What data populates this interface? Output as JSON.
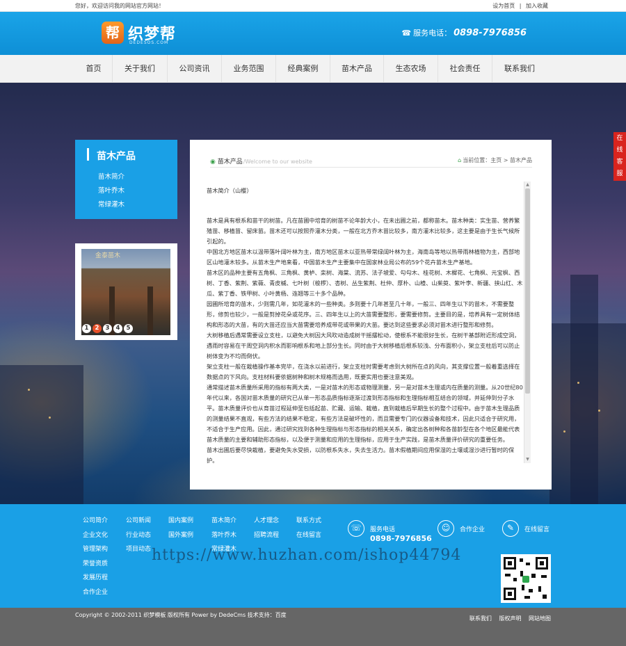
{
  "topbar": {
    "greeting": "您好，欢迎访问我的网站官方网站！",
    "set_home": "设为首页",
    "separator": "|",
    "add_fav": "加入收藏"
  },
  "header": {
    "logo_mark": "帮",
    "logo_text": "织梦帮",
    "logo_sub": "DEDESOS.COM",
    "hotline_label": "服务电话：",
    "hotline_number": "0898-7976856"
  },
  "nav": [
    "首页",
    "关于我们",
    "公司资讯",
    "业务范围",
    "经典案例",
    "苗木产品",
    "生态农场",
    "社会责任",
    "联系我们"
  ],
  "sidebar": {
    "title": "苗木产品",
    "items": [
      "苗木简介",
      "落叶乔木",
      "常绿灌木"
    ]
  },
  "slider": {
    "dots": [
      "1",
      "2",
      "3",
      "4",
      "5"
    ],
    "active_index": 2,
    "sign": "金泰苗木"
  },
  "content": {
    "title": "苗木产品",
    "title_en": "/Welcome to our website",
    "crumb_label": "当前位置：",
    "crumb_home": "主页",
    "crumb_sep": ">",
    "crumb_current": "苗木产品",
    "subtitle": "苗木简介（山樱）",
    "paragraphs": [
      "苗木是具有根系和苗干的树苗。凡在苗圃中培育的树苗不论年龄大小，在未出圃之前，都称苗木。苗木种类：实生苗、营养繁殖苗、移植苗、留床苗。苗木还可以按照乔灌木分类，一般在北方乔木苗比较多，南方灌木比较多，这主要是由于生长气候所引起的。",
      "中国北方地区苗木以温带落叶阔叶林为主，南方地区苗木以亚热带常绿阔叶林为主，海南岛等地以热带雨林植物为主，西部地区山地灌木较多。从苗木生产地来看，中国苗木生产主要集中在国家林业局公布的59个花卉苗木生产基地。",
      "苗木区的品种主要有五角枫、三角枫、黄栌、栾树、海棠、流苏、法子坡爱、勾勾木、桂花树、木樨花、七角枫、元宝枫、西树、丁香、紫荆、紫薇、青皮槭、七叶树（梭椤）、杏树、丛生紫荆、杜仲、厚朴、山楂、山茱萸、紫叶李、新疆、挟山红、木瓜、紫丁香、铁甲树、小叶黄杨、连翘等三十多个品种。",
      "园圃所培育的苗木，少则需几年，如花灌木的一些种类。多则要十几年甚至几十年，一般三、四年生以下的苗木，不需要整形，修剪也较少，一般是剪掉花朵或花序。三、四年生以上的大苗需要整形，要需要修剪。主要目的是，培养具有一定树体结构和形态的大苗，有的大苗还应当大苗需要培养成带花或带果的大苗。要达到这些要求必须对苗木进行整形和修剪。",
      "大树移植后遇常需要设立支柱，以避免大树因大风吹动造成树干摇摆松动，使根系不能很好生长，在树干基部附近形成空洞，遇雨时容易在干周空洞内积水而影响根系和地上部分生长。同时由于大树移植后根系较浅、分布面积小，架立支柱后可以防止树体变为不均而倒伏。",
      "架立支柱一般在栽植操作基本完毕，在浇水以前进行，架立支柱时需要考虑到大树所在点的风向，其支撑位置一般着重选择在数据点的下风向。支柱材料要依据树种和树木规格而选用，既要实用也要注意美观。",
      "通常描述苗木质量所采用的指标有两大类，一是对苗木的形态或物理测量，另一是对苗木生理或内在质量的测量。从20世纪80年代以来，各国对苗木质量的研究已从单一形态品质指标逐渐过渡到形态指标和生理指标相互结合的领域，并延伸到分子水平。苗木质量评价也从育苗过程延伸至包括起苗、贮藏、运输、栽植，直到栽植后早期生长的整个过程中。由于苗木生理品质的测量结果不直观，有些方法的结果不稳定，有些方法是破坏性的，而且需要专门的仪器设备和技术，因此只适合于研究用，不适合于生产应用。因此，通过研究找到各种生理指标与形态指标的相关关系，确定出各树种和各苗龄型在各个地区最能代表苗木质量的主要和辅助形态指标，以及便于测量和应用的生理指标，应用于生产实践，是苗木质量评价研究的重要任务。",
      "苗木出圃后要尽快栽植，要避免失水受损，以防根系失水，失去生活力。苗木假植期间应用保湿的土壤或湿沙进行暂时的保护。"
    ]
  },
  "online_service": "在线客服",
  "footer": {
    "columns": [
      [
        "公司简介",
        "企业文化",
        "管理架构",
        "荣誉资质",
        "发展历程",
        "合作企业"
      ],
      [
        "公司新闻",
        "行业动态",
        "项目动态"
      ],
      [
        "国内案例",
        "国外案例"
      ],
      [
        "苗木简介",
        "落叶乔木",
        "常绿灌木"
      ],
      [
        "人才理念",
        "招聘流程"
      ],
      [
        "联系方式",
        "在线留言"
      ]
    ],
    "service_label": "服务电话",
    "service_number": "0898-7976856",
    "partner_label": "合作企业",
    "message_label": "在线留言",
    "watermark": "https://www.huzhan.com/ishop44794"
  },
  "copyright": {
    "text": "Copyright © 2002-2011 织梦模板 版权所有 Power by DedeCms 技术支持：百度",
    "links": [
      "联系我们",
      "版权声明",
      "网站地图"
    ]
  },
  "colors": {
    "brand_blue": "#1aa0e6",
    "accent_orange": "#e8512a",
    "service_red": "#d9241e"
  }
}
